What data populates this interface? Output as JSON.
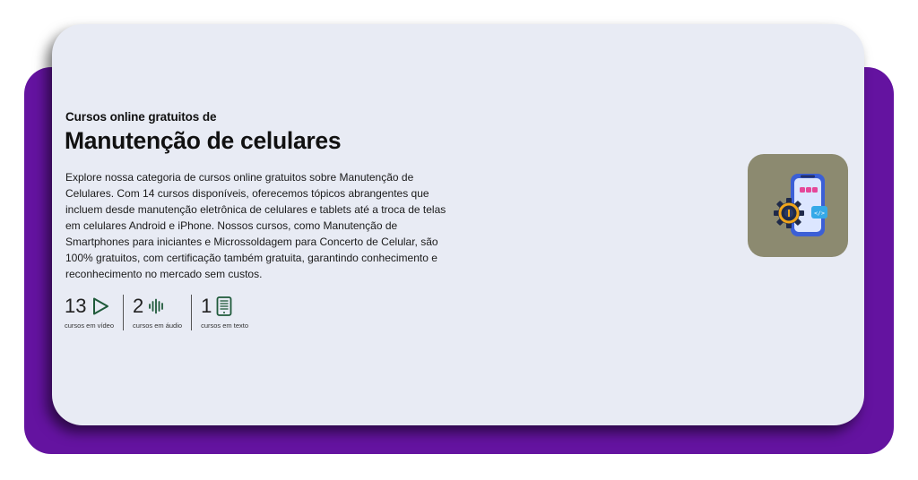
{
  "header": {
    "eyebrow": "Cursos online gratuitos de",
    "title": "Manutenção de celulares"
  },
  "description": "Explore nossa categoria de cursos online gratuitos sobre Manutenção de Celulares. Com 14 cursos disponíveis, oferecemos tópicos abrangentes que incluem desde manutenção eletrônica de celulares e tablets até a troca de telas em celulares Android e iPhone. Nossos cursos, como Manutenção de Smartphones para iniciantes e Microssoldagem para Concerto de Celular, são 100% gratuitos, com certificação também gratuita, garantindo conhecimento e reconhecimento no mercado sem custos.",
  "stats": [
    {
      "count": "13",
      "label": "cursos em vídeo",
      "icon": "play-icon"
    },
    {
      "count": "2",
      "label": "cursos em áudio",
      "icon": "audio-waveform-icon"
    },
    {
      "count": "1",
      "label": "cursos em texto",
      "icon": "ebook-icon"
    }
  ],
  "illustration": {
    "icon": "smartphone-repair-gear-icon",
    "background": "#8c8a70"
  },
  "colors": {
    "purple": "#6413a0",
    "card": "#e8ebf4",
    "stat_icon": "#1f5a3a"
  }
}
